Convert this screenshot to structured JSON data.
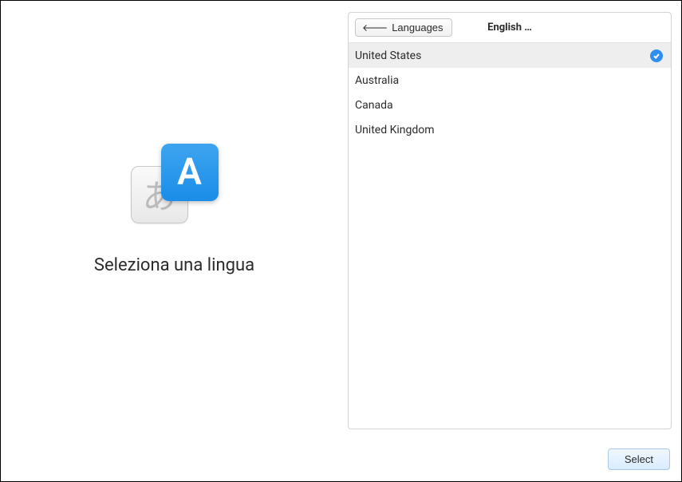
{
  "left": {
    "bg_char": "あ",
    "fg_char": "A",
    "prompt": "Seleziona una lingua"
  },
  "panel": {
    "back_label": "Languages",
    "title": "English …",
    "items": [
      {
        "label": "United States",
        "selected": true
      },
      {
        "label": "Australia",
        "selected": false
      },
      {
        "label": "Canada",
        "selected": false
      },
      {
        "label": "United Kingdom",
        "selected": false
      }
    ]
  },
  "footer": {
    "select_label": "Select"
  }
}
